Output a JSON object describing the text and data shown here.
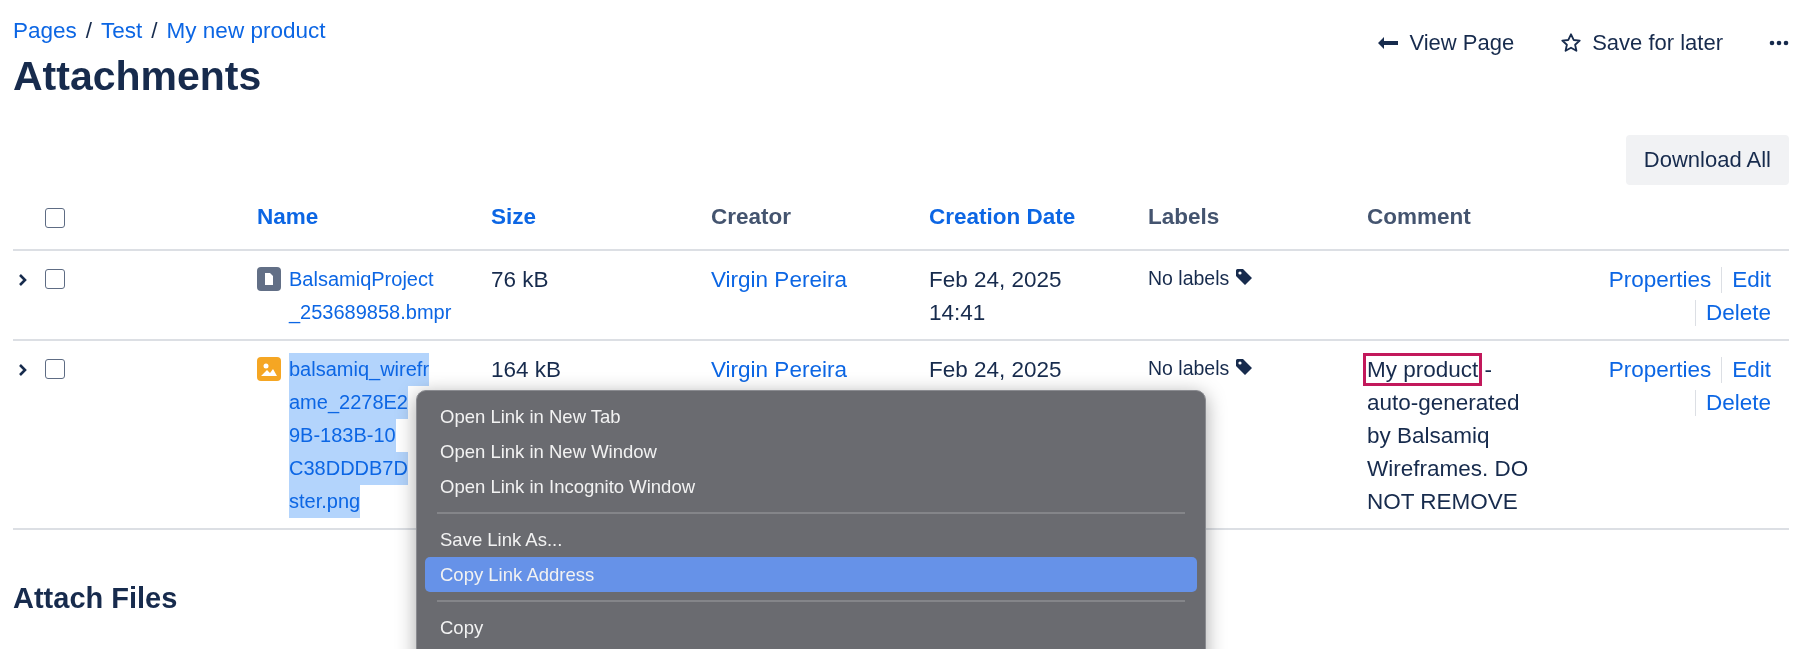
{
  "breadcrumbs": [
    {
      "label": "Pages"
    },
    {
      "separator": "/",
      "label": "Test"
    },
    {
      "separator": "/",
      "label": "My new product"
    }
  ],
  "title": "Attachments",
  "page_actions": [
    {
      "kind": "back",
      "label": "View Page"
    },
    {
      "kind": "star",
      "label": "Save for later"
    },
    {
      "kind": "more"
    }
  ],
  "download_button": "Download All",
  "table": {
    "columns": [
      {
        "label": "Name",
        "sortable": true
      },
      {
        "label": "Size",
        "sortable": true
      },
      {
        "label": "Creator",
        "sortable": false
      },
      {
        "label": "Creation Date",
        "sortable": true
      },
      {
        "label": "Labels",
        "sortable": false
      },
      {
        "label": "Comment",
        "sortable": false
      }
    ],
    "all_checked": false,
    "rows": [
      {
        "checked": false,
        "kind": "file",
        "name_lines": [
          "BalsamiqProject",
          "_253689858.bmpr"
        ],
        "text_selected": false,
        "size": "76 kB",
        "creator": "Virgin Pereira",
        "date_lines": [
          "Feb 24, 2025",
          "14:41"
        ],
        "labels": "No labels",
        "actions": [
          "Properties",
          "Edit",
          "Delete"
        ]
      },
      {
        "checked": false,
        "kind": "image",
        "name_lines": [
          "balsamiq_wirefr",
          "ame_2278E2",
          "9B-183B-10",
          "C38DDDB7D",
          "ster.png"
        ],
        "text_selected": true,
        "size": "164 kB",
        "creator": "Virgin Pereira",
        "date_lines": [
          "Feb 24, 2025"
        ],
        "labels": "No labels",
        "comment": {
          "boxed": "My product",
          "rest": " - auto-generated by Balsamiq Wireframes. DO NOT REMOVE"
        },
        "actions": [
          "Properties",
          "Edit",
          "Delete"
        ]
      }
    ]
  },
  "section_title": "Attach Files",
  "context_menu": {
    "groups": [
      [
        {
          "label": "Open Link in New Tab",
          "highlighted": false
        },
        {
          "label": "Open Link in New Window",
          "highlighted": false
        },
        {
          "label": "Open Link in Incognito Window",
          "highlighted": false
        }
      ],
      [
        {
          "label": "Save Link As...",
          "highlighted": false
        },
        {
          "label": "Copy Link Address",
          "highlighted": true
        }
      ],
      [
        {
          "label": "Copy",
          "highlighted": false
        }
      ]
    ]
  }
}
